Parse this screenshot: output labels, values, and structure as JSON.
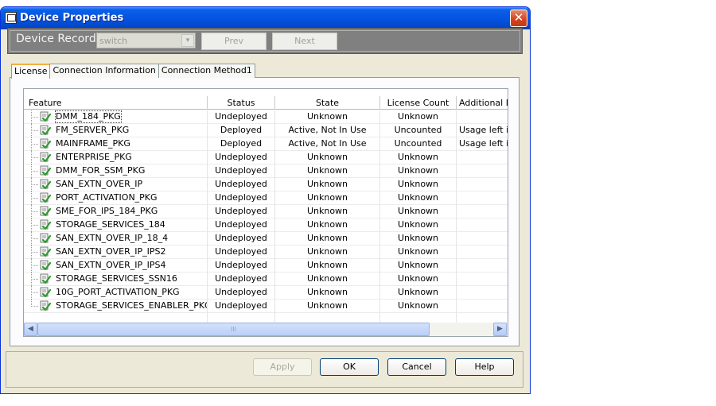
{
  "window": {
    "title": "Device Properties",
    "close_glyph": "✕"
  },
  "records": {
    "label": "Device Records",
    "combo_value": "switch",
    "combo_arrow": "▾",
    "prev_label": "Prev",
    "next_label": "Next"
  },
  "tabs": [
    {
      "label": "License",
      "active": true
    },
    {
      "label": "Connection Information",
      "active": false
    },
    {
      "label": "Connection Method1",
      "active": false
    }
  ],
  "table": {
    "columns": [
      "Feature",
      "Status",
      "State",
      "License Count",
      "Additional L"
    ],
    "rows": [
      {
        "feature": "DMM_184_PKG",
        "status": "Undeployed",
        "state": "Unknown",
        "count": "Unknown",
        "additional": ""
      },
      {
        "feature": "FM_SERVER_PKG",
        "status": "Deployed",
        "state": "Active, Not In Use",
        "count": "Uncounted",
        "additional": "Usage left is"
      },
      {
        "feature": "MAINFRAME_PKG",
        "status": "Deployed",
        "state": "Active, Not In Use",
        "count": "Uncounted",
        "additional": "Usage left is"
      },
      {
        "feature": "ENTERPRISE_PKG",
        "status": "Undeployed",
        "state": "Unknown",
        "count": "Unknown",
        "additional": ""
      },
      {
        "feature": "DMM_FOR_SSM_PKG",
        "status": "Undeployed",
        "state": "Unknown",
        "count": "Unknown",
        "additional": ""
      },
      {
        "feature": "SAN_EXTN_OVER_IP",
        "status": "Undeployed",
        "state": "Unknown",
        "count": "Unknown",
        "additional": ""
      },
      {
        "feature": "PORT_ACTIVATION_PKG",
        "status": "Undeployed",
        "state": "Unknown",
        "count": "Unknown",
        "additional": ""
      },
      {
        "feature": "SME_FOR_IPS_184_PKG",
        "status": "Undeployed",
        "state": "Unknown",
        "count": "Unknown",
        "additional": ""
      },
      {
        "feature": "STORAGE_SERVICES_184",
        "status": "Undeployed",
        "state": "Unknown",
        "count": "Unknown",
        "additional": ""
      },
      {
        "feature": "SAN_EXTN_OVER_IP_18_4",
        "status": "Undeployed",
        "state": "Unknown",
        "count": "Unknown",
        "additional": ""
      },
      {
        "feature": "SAN_EXTN_OVER_IP_IPS2",
        "status": "Undeployed",
        "state": "Unknown",
        "count": "Unknown",
        "additional": ""
      },
      {
        "feature": "SAN_EXTN_OVER_IP_IPS4",
        "status": "Undeployed",
        "state": "Unknown",
        "count": "Unknown",
        "additional": ""
      },
      {
        "feature": "STORAGE_SERVICES_SSN16",
        "status": "Undeployed",
        "state": "Unknown",
        "count": "Unknown",
        "additional": ""
      },
      {
        "feature": "10G_PORT_ACTIVATION_PKG",
        "status": "Undeployed",
        "state": "Unknown",
        "count": "Unknown",
        "additional": ""
      },
      {
        "feature": "STORAGE_SERVICES_ENABLER_PKG",
        "status": "Undeployed",
        "state": "Unknown",
        "count": "Unknown",
        "additional": ""
      }
    ],
    "row_icon": "license-check-icon"
  },
  "scrollbar": {
    "left_glyph": "◀",
    "right_glyph": "▶",
    "grip": "III"
  },
  "buttons": {
    "apply": "Apply",
    "ok": "OK",
    "cancel": "Cancel",
    "help": "Help"
  },
  "colors": {
    "titlebar": "#0554e3",
    "close": "#d0421f",
    "check": "#2e9b2e"
  }
}
